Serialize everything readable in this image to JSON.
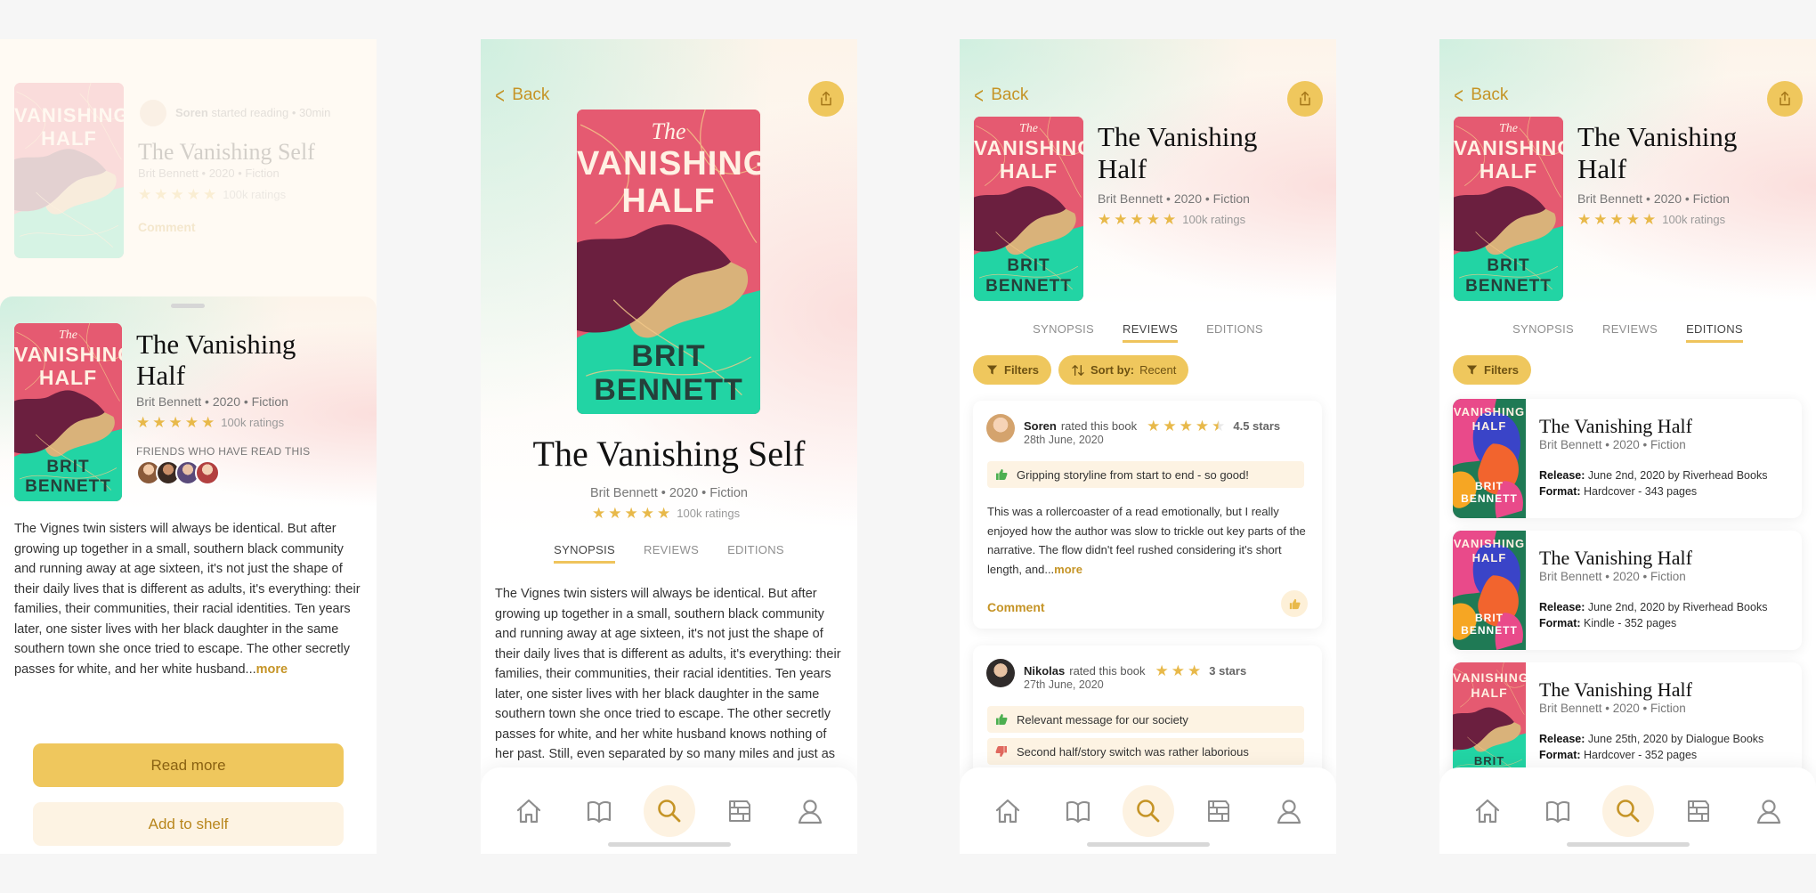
{
  "colors": {
    "accent": "#efc75d",
    "accent_text": "#c59426",
    "light_accent": "#fdf2e1",
    "cover_pink": "#e55a71",
    "cover_green": "#22d4a4",
    "cover_maroon": "#6b1f3f"
  },
  "book": {
    "title_short": "The Vanishing Half",
    "title_line1": "The Vanishing",
    "title_line2": "Half",
    "title_alt": "The Vanishing Self",
    "meta": "Brit Bennett • 2020 • Fiction",
    "ratings": "100k ratings",
    "cover_the": "The",
    "cover_title_1": "VANISHING",
    "cover_title_2": "HALF",
    "cover_author_1": "BRIT",
    "cover_author_2": "BENNETT"
  },
  "nav": {
    "back": "Back",
    "tabs": [
      "SYNOPSIS",
      "REVIEWS",
      "EDITIONS"
    ],
    "bottom": [
      "home-icon",
      "book-icon",
      "search-icon",
      "shelf-icon",
      "profile-icon"
    ]
  },
  "screen1": {
    "feed_user": "Soren",
    "feed_action": "started reading",
    "feed_time": "• 30min",
    "feed_title": "The Vanishing Self",
    "feed_meta": "Brit Bennett • 2020 • Fiction",
    "feed_ratings": "100k ratings",
    "feed_comment": "Comment",
    "friends_label": "FRIENDS WHO HAVE READ THIS",
    "synopsis": "The Vignes twin sisters will always be identical. But after growing up together in a small, southern black community and running away at age sixteen, it's not just the shape of their daily lives that is different as adults, it's everything: their families, their communities, their racial identities. Ten years later, one sister lives with her black daughter in the same southern town she once tried to escape. The other secretly passes for white, and her white husband...",
    "more": "more",
    "read_more": "Read more",
    "add_to_shelf": "Add to shelf"
  },
  "screen2": {
    "synopsis": "The Vignes twin sisters will always be identical. But after growing up together in a small, southern black community and running away at age sixteen, it's not just the shape of their daily lives that is different as adults, it's everything: their families, their communities, their racial identities. Ten years later, one sister lives with her black daughter in the same southern town she once tried to escape. The other secretly passes for white, and her white husband knows nothing of her past. Still, even separated by so many miles and just as"
  },
  "screen3": {
    "filters": "Filters",
    "sort_label": "Sort by:",
    "sort_value": "Recent",
    "reviews": [
      {
        "user": "Soren",
        "action": "rated this book",
        "stars": 4.5,
        "stars_label": "4.5 stars",
        "date": "28th June, 2020",
        "highlight": "Gripping storyline from start to end - so good!",
        "body": "This was a rollercoaster of a read emotionally, but I really enjoyed how the author was slow to trickle out key parts of the narrative. The flow didn't feel rushed considering it's short length, and...",
        "more": "more",
        "comment": "Comment"
      },
      {
        "user": "Nikolas",
        "action": "rated this book",
        "stars": 3,
        "stars_label": "3 stars",
        "date": "27th June, 2020",
        "pro": "Relevant message for our society",
        "con": "Second half/story switch was rather laborious"
      }
    ]
  },
  "screen4": {
    "filters": "Filters",
    "release_label": "Release:",
    "format_label": "Format:",
    "editions": [
      {
        "title": "The Vanishing Half",
        "meta": "Brit Bennett • 2020 • Fiction",
        "release": "June 2nd, 2020 by Riverhead Books",
        "format": "Hardcover - 343 pages",
        "cover": "colorful"
      },
      {
        "title": "The Vanishing Half",
        "meta": "Brit Bennett • 2020 • Fiction",
        "release": "June 2nd, 2020 by Riverhead Books",
        "format": "Kindle - 352 pages",
        "cover": "colorful"
      },
      {
        "title": "The Vanishing Half",
        "meta": "Brit Bennett • 2020 • Fiction",
        "release": "June 25th, 2020 by Dialogue Books",
        "format": "Hardcover - 352 pages",
        "cover": "pink"
      }
    ]
  }
}
